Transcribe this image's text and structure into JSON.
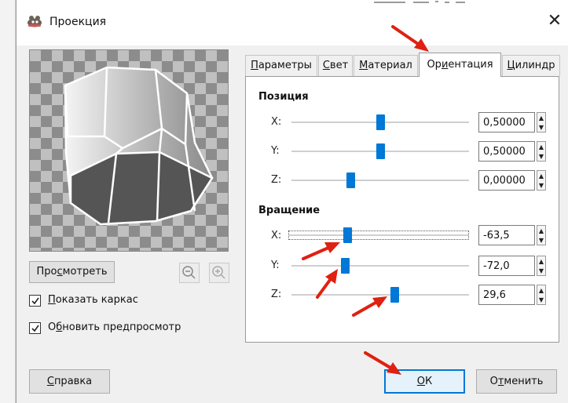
{
  "window": {
    "title": "Проекция",
    "close_glyph": "✕"
  },
  "preview": {
    "button": {
      "pre": "Про",
      "u": "с",
      "post": "мотреть"
    },
    "zoom_out_icon": "zoom-out-icon",
    "zoom_in_icon": "zoom-in-icon"
  },
  "checkboxes": [
    {
      "pre": "",
      "u": "П",
      "post": "оказать каркас",
      "checked": true
    },
    {
      "pre": "О",
      "u": "б",
      "post": "новить предпросмотр",
      "checked": true
    }
  ],
  "tabs": [
    {
      "pre": "",
      "u": "П",
      "post": "араметры",
      "active": false
    },
    {
      "pre": "",
      "u": "С",
      "post": "вет",
      "active": false
    },
    {
      "pre": "",
      "u": "М",
      "post": "атериал",
      "active": false
    },
    {
      "pre": "Ор",
      "u": "и",
      "post": "ентация",
      "active": true
    },
    {
      "pre": "",
      "u": "Ц",
      "post": "илиндр",
      "active": false
    }
  ],
  "position": {
    "title": "Позиция",
    "rows": [
      {
        "label": "X:",
        "value": "0,50000",
        "fraction": 0.5
      },
      {
        "label": "Y:",
        "value": "0,50000",
        "fraction": 0.5
      },
      {
        "label": "Z:",
        "value": "0,00000",
        "fraction": 0.33
      }
    ]
  },
  "rotation": {
    "title": "Вращение",
    "rows": [
      {
        "label": "X:",
        "value": "-63,5",
        "fraction": 0.32
      },
      {
        "label": "Y:",
        "value": "-72,0",
        "fraction": 0.3
      },
      {
        "label": "Z:",
        "value": "29,6",
        "fraction": 0.58
      }
    ]
  },
  "buttons": {
    "help": {
      "pre": "",
      "u": "С",
      "post": "правка"
    },
    "ok": {
      "pre": "",
      "u": "О",
      "post": "К"
    },
    "cancel": {
      "pre": "О",
      "u": "т",
      "post": "менить"
    }
  },
  "colors": {
    "accent": "#0078d7",
    "annotation_arrow": "#e02010"
  }
}
